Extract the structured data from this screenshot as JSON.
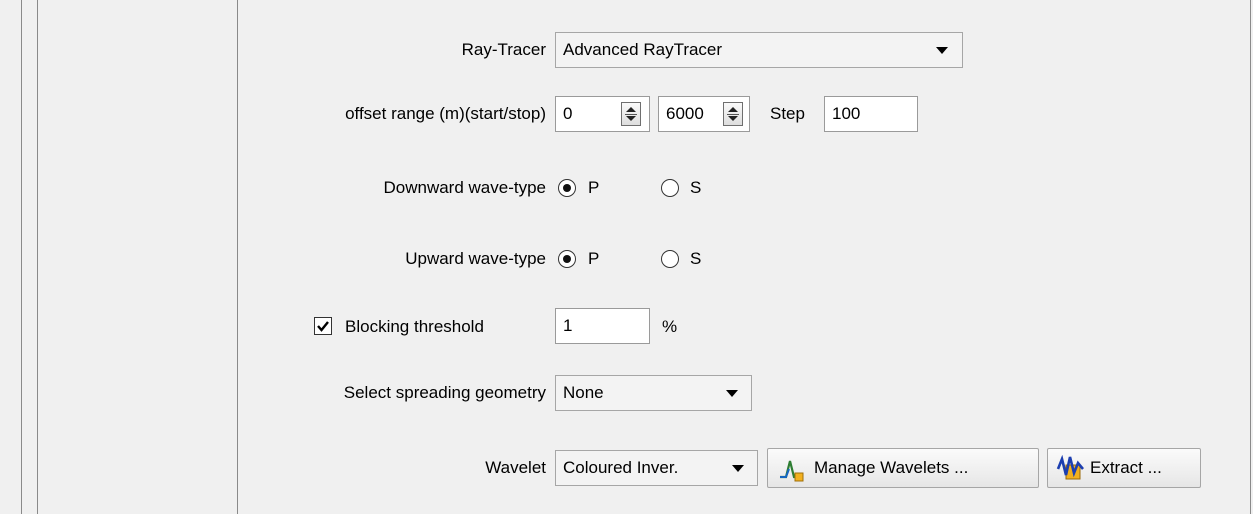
{
  "raytracer": {
    "label": "Ray-Tracer",
    "value": "Advanced RayTracer"
  },
  "offset": {
    "label": "offset range (m)(start/stop)",
    "start": "0",
    "stop": "6000",
    "step_label": "Step",
    "step": "100"
  },
  "downward": {
    "label": "Downward wave-type",
    "option_p": "P",
    "option_s": "S",
    "selected": "P"
  },
  "upward": {
    "label": "Upward wave-type",
    "option_p": "P",
    "option_s": "S",
    "selected": "P"
  },
  "blocking": {
    "label": "Blocking threshold",
    "checked": true,
    "value": "1",
    "unit": "%"
  },
  "spreading": {
    "label": "Select spreading geometry",
    "value": "None"
  },
  "wavelet": {
    "label": "Wavelet",
    "value": "Coloured Inver.",
    "manage_label": "Manage Wavelets ...",
    "extract_label": "Extract ..."
  },
  "icons": {
    "manage": "wavelet-chart-icon",
    "extract": "wavelet-extract-icon"
  }
}
